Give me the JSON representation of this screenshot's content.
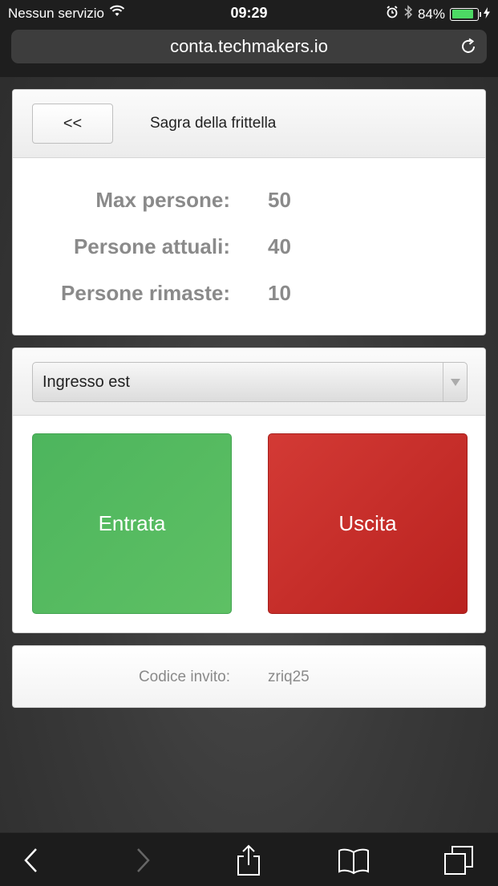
{
  "status": {
    "carrier": "Nessun servizio",
    "time": "09:29",
    "battery": "84%",
    "battery_level": 0.84
  },
  "browser": {
    "url": "conta.techmakers.io"
  },
  "event": {
    "back_label": "<<",
    "title": "Sagra della frittella"
  },
  "stats": [
    {
      "label": "Max persone:",
      "value": "50"
    },
    {
      "label": "Persone attuali:",
      "value": "40"
    },
    {
      "label": "Persone rimaste:",
      "value": "10"
    }
  ],
  "gate": {
    "selected": "Ingresso est"
  },
  "actions": {
    "enter_label": "Entrata",
    "exit_label": "Uscita"
  },
  "invite": {
    "label": "Codice invito:",
    "code": "zriq25"
  },
  "colors": {
    "enter": "#5cb85c",
    "exit": "#c9302c",
    "battery": "#4cd964"
  }
}
